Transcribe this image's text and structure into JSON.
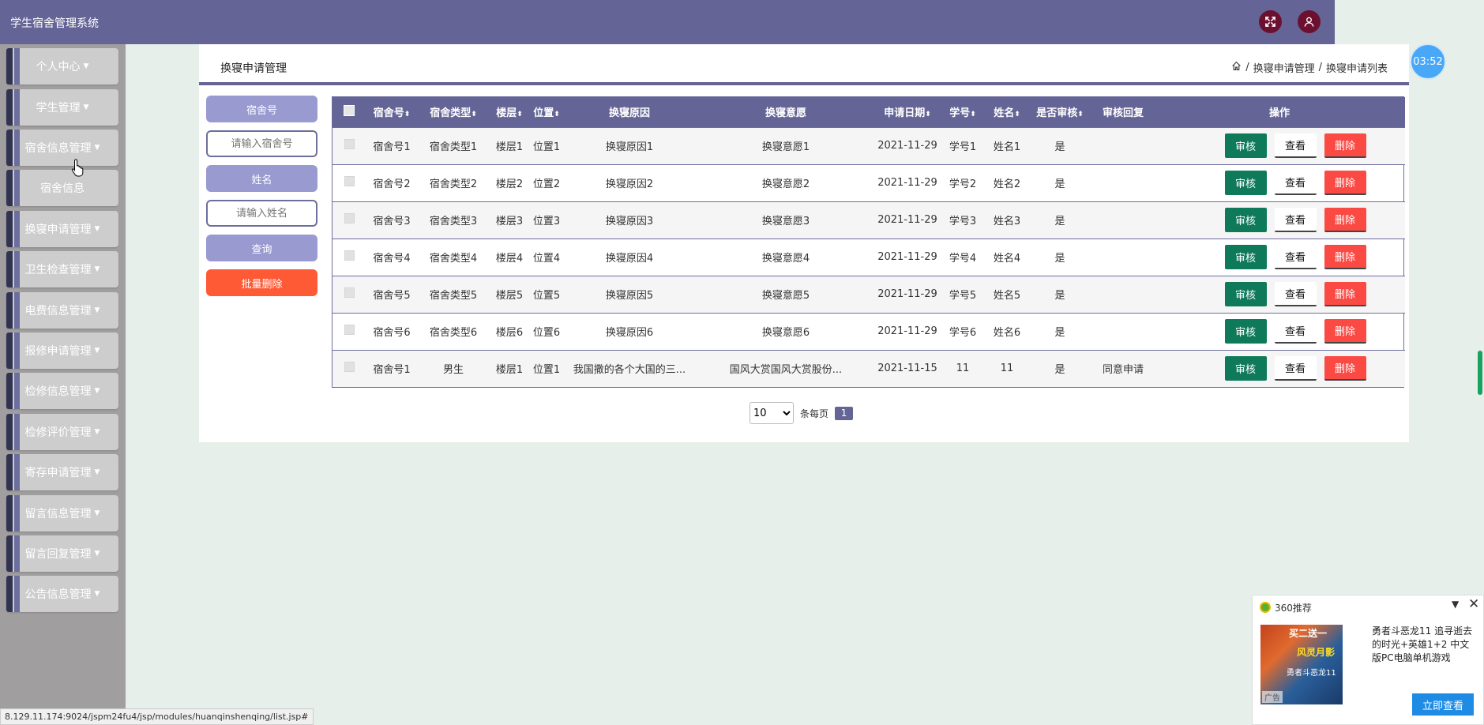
{
  "header": {
    "title": "学生宿舍管理系统"
  },
  "sidebar": {
    "items": [
      {
        "label": "个人中心",
        "caret": true
      },
      {
        "label": "学生管理",
        "caret": true
      },
      {
        "label": "宿舍信息管理",
        "caret": true
      },
      {
        "label": "宿舍信息",
        "caret": false
      },
      {
        "label": "换寝申请管理",
        "caret": true
      },
      {
        "label": "卫生检查管理",
        "caret": true
      },
      {
        "label": "电费信息管理",
        "caret": true
      },
      {
        "label": "报修申请管理",
        "caret": true
      },
      {
        "label": "检修信息管理",
        "caret": true
      },
      {
        "label": "检修评价管理",
        "caret": true
      },
      {
        "label": "寄存申请管理",
        "caret": true
      },
      {
        "label": "留言信息管理",
        "caret": true
      },
      {
        "label": "留言回复管理",
        "caret": true
      },
      {
        "label": "公告信息管理",
        "caret": true
      }
    ]
  },
  "page": {
    "title": "换寝申请管理",
    "breadcrumb": [
      "换寝申请管理",
      "换寝申请列表"
    ]
  },
  "search": {
    "field1_label": "宿舍号",
    "field1_placeholder": "请输入宿舍号",
    "field2_label": "姓名",
    "field2_placeholder": "请输入姓名",
    "query_button": "查询",
    "batch_delete_button": "批量删除"
  },
  "table": {
    "headers": [
      "宿舍号",
      "宿舍类型",
      "楼层",
      "位置",
      "换寝原因",
      "换寝意愿",
      "申请日期",
      "学号",
      "姓名",
      "是否审核",
      "审核回复",
      "操作"
    ],
    "rows": [
      [
        "宿舍号1",
        "宿舍类型1",
        "楼层1",
        "位置1",
        "换寝原因1",
        "换寝意愿1",
        "2021-11-29",
        "学号1",
        "姓名1",
        "是",
        ""
      ],
      [
        "宿舍号2",
        "宿舍类型2",
        "楼层2",
        "位置2",
        "换寝原因2",
        "换寝意愿2",
        "2021-11-29",
        "学号2",
        "姓名2",
        "是",
        ""
      ],
      [
        "宿舍号3",
        "宿舍类型3",
        "楼层3",
        "位置3",
        "换寝原因3",
        "换寝意愿3",
        "2021-11-29",
        "学号3",
        "姓名3",
        "是",
        ""
      ],
      [
        "宿舍号4",
        "宿舍类型4",
        "楼层4",
        "位置4",
        "换寝原因4",
        "换寝意愿4",
        "2021-11-29",
        "学号4",
        "姓名4",
        "是",
        ""
      ],
      [
        "宿舍号5",
        "宿舍类型5",
        "楼层5",
        "位置5",
        "换寝原因5",
        "换寝意愿5",
        "2021-11-29",
        "学号5",
        "姓名5",
        "是",
        ""
      ],
      [
        "宿舍号6",
        "宿舍类型6",
        "楼层6",
        "位置6",
        "换寝原因6",
        "换寝意愿6",
        "2021-11-29",
        "学号6",
        "姓名6",
        "是",
        ""
      ],
      [
        "宿舍号1",
        "男生",
        "楼层1",
        "位置1",
        "我国撒的各个大国的三...",
        "国风大赏国风大赏股份...",
        "2021-11-15",
        "11",
        "11",
        "是",
        "同意申请"
      ]
    ],
    "actions": {
      "audit": "审核",
      "view": "查看",
      "delete": "删除"
    }
  },
  "pagination": {
    "page_size": "10",
    "page_size_options": [
      "10"
    ],
    "per_page_label": "条每页",
    "current_page": "1"
  },
  "timer": "03:52",
  "status_url": "8.129.11.174:9024/jspm24fu4/jsp/modules/huanqinshenqing/list.jsp#",
  "ad": {
    "title": "360推荐",
    "text": "勇者斗恶龙11 追寻逝去的时光+英雄1+2 中文版PC电脑单机游戏",
    "button": "立即查看",
    "tag": "广告",
    "image_text": [
      "买二送一",
      "风灵月影",
      "勇者斗恶龙11"
    ]
  },
  "colors": {
    "primary": "#646596",
    "audit": "#0f7a59",
    "delete": "#fb4a44",
    "batch_delete": "#ff5a36"
  }
}
